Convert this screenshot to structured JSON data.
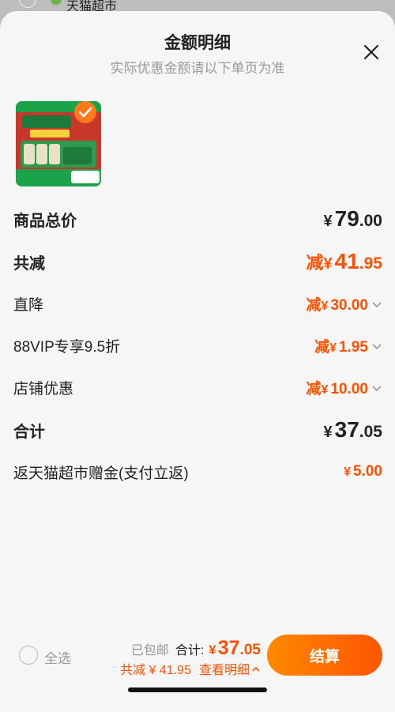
{
  "background_list": {
    "store_name": "天猫超市"
  },
  "sheet": {
    "title": "金额明细",
    "subtitle": "实际优惠金额请以下单页为准"
  },
  "rows": {
    "total_price": {
      "label": "商品总价",
      "symbol": "¥",
      "int": "79",
      "dec": ".00"
    },
    "discount_total": {
      "label": "共减",
      "prefix": "减",
      "symbol": "¥",
      "int": "41",
      "dec": ".95"
    },
    "direct": {
      "label": "直降",
      "prefix": "减",
      "symbol": "¥",
      "value": "30.00"
    },
    "vip": {
      "label": "88VIP专享9.5折",
      "prefix": "减",
      "symbol": "¥",
      "value": "1.95"
    },
    "store": {
      "label": "店铺优惠",
      "prefix": "减",
      "symbol": "¥",
      "value": "10.00"
    },
    "sum": {
      "label": "合计",
      "symbol": "¥",
      "int": "37",
      "dec": ".05"
    },
    "rebate": {
      "label": "返天猫超市赠金(支付立返)",
      "symbol": "¥",
      "value": "5.00"
    }
  },
  "footer": {
    "select_all": "全选",
    "shipping": "已包邮",
    "total_label": "合计:",
    "total_symbol": "¥",
    "total_int": "37",
    "total_dec": ".05",
    "discount_summary": "共减 ¥ 41.95",
    "view_detail": "查看明细",
    "checkout": "结算"
  },
  "colors": {
    "accent": "#ff5000",
    "checkout_start": "#ff8a00",
    "checkout_end": "#ff5500"
  }
}
